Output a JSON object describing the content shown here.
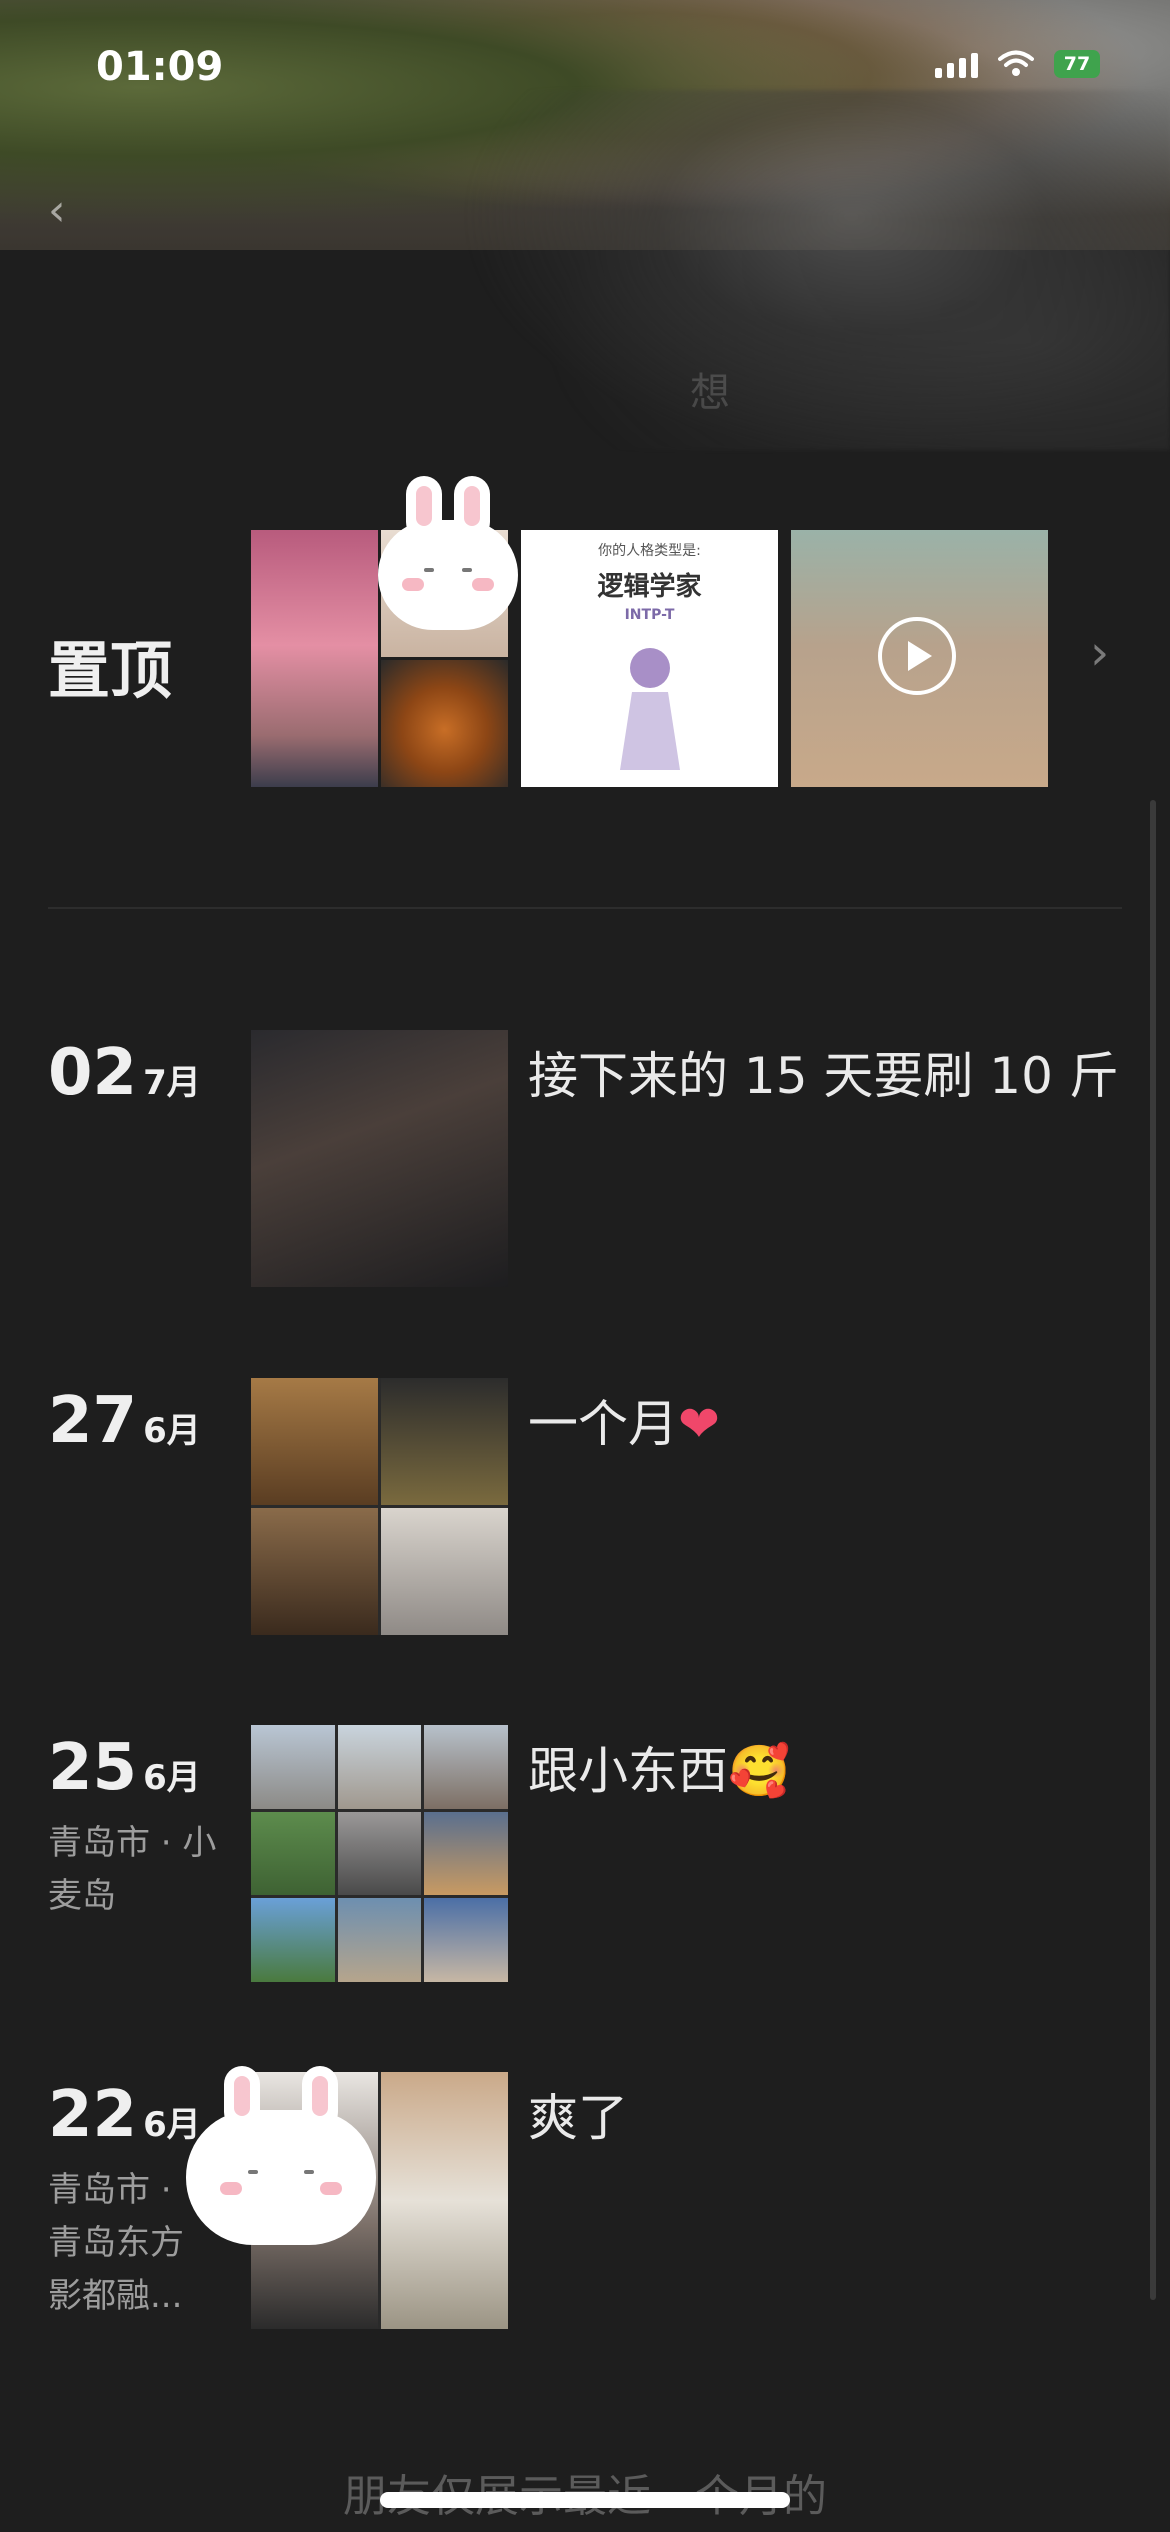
{
  "status_bar": {
    "time": "01:09",
    "battery": "77"
  },
  "header": {
    "brush_text": "想"
  },
  "pinned": {
    "label": "置顶",
    "card": {
      "title_small": "你的人格类型是:",
      "title_big": "逻辑学家",
      "tag": "INTP-T"
    }
  },
  "posts": [
    {
      "day": "02",
      "month": "7月",
      "location": "",
      "caption": "接下来的 15 天要刷 10 斤"
    },
    {
      "day": "27",
      "month": "6月",
      "location": "",
      "caption": "一个月",
      "emoji": "❤"
    },
    {
      "day": "25",
      "month": "6月",
      "location": "青岛市 · 小麦岛",
      "caption": "跟小东西",
      "emoji": "🥰"
    },
    {
      "day": "22",
      "month": "6月",
      "location": "青岛市 · 青岛东方影都融...",
      "caption": "爽了"
    }
  ],
  "footer": {
    "note": "朋友仅展示最近一个月的"
  },
  "icons": [
    "back-chevron-icon",
    "signal-icon",
    "wifi-icon",
    "battery-icon",
    "play-icon",
    "chevron-right-icon",
    "heart-emoji-icon",
    "smiling-hearts-emoji-icon",
    "rabbit-sticker-icon"
  ]
}
